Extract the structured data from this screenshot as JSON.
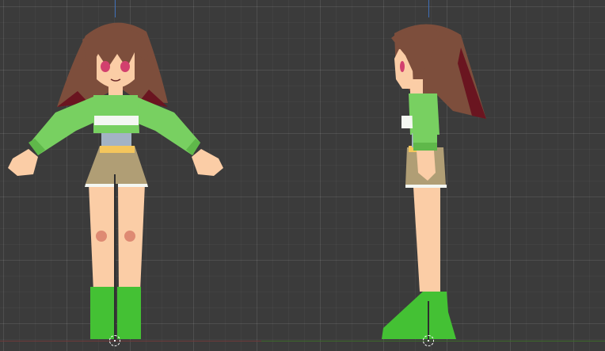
{
  "viewport": {
    "background": "#3b3b3b",
    "grid_major": "rgba(255,255,255,0.07)",
    "grid_minor": "rgba(255,255,255,0.03)",
    "x_axis_color": "#6f3a3a",
    "y_axis_color": "#3d6a2a",
    "z_axis_color": "#3f6fb6"
  },
  "model": {
    "hair": "#7d4e3c",
    "hair_dark": "#6a1520",
    "skin": "#fbcda6",
    "skin_shadow": "#f1b38d",
    "sweater": "#78d061",
    "sweater_stripe": "#f4f7f2",
    "undershirt": "#a3b3c4",
    "shorts": "#b09e75",
    "belt": "#f4c65c",
    "boots": "#44c134",
    "eyes": "#d2406e",
    "blush": "#de8a73"
  },
  "views": [
    "front-view",
    "side-view"
  ]
}
